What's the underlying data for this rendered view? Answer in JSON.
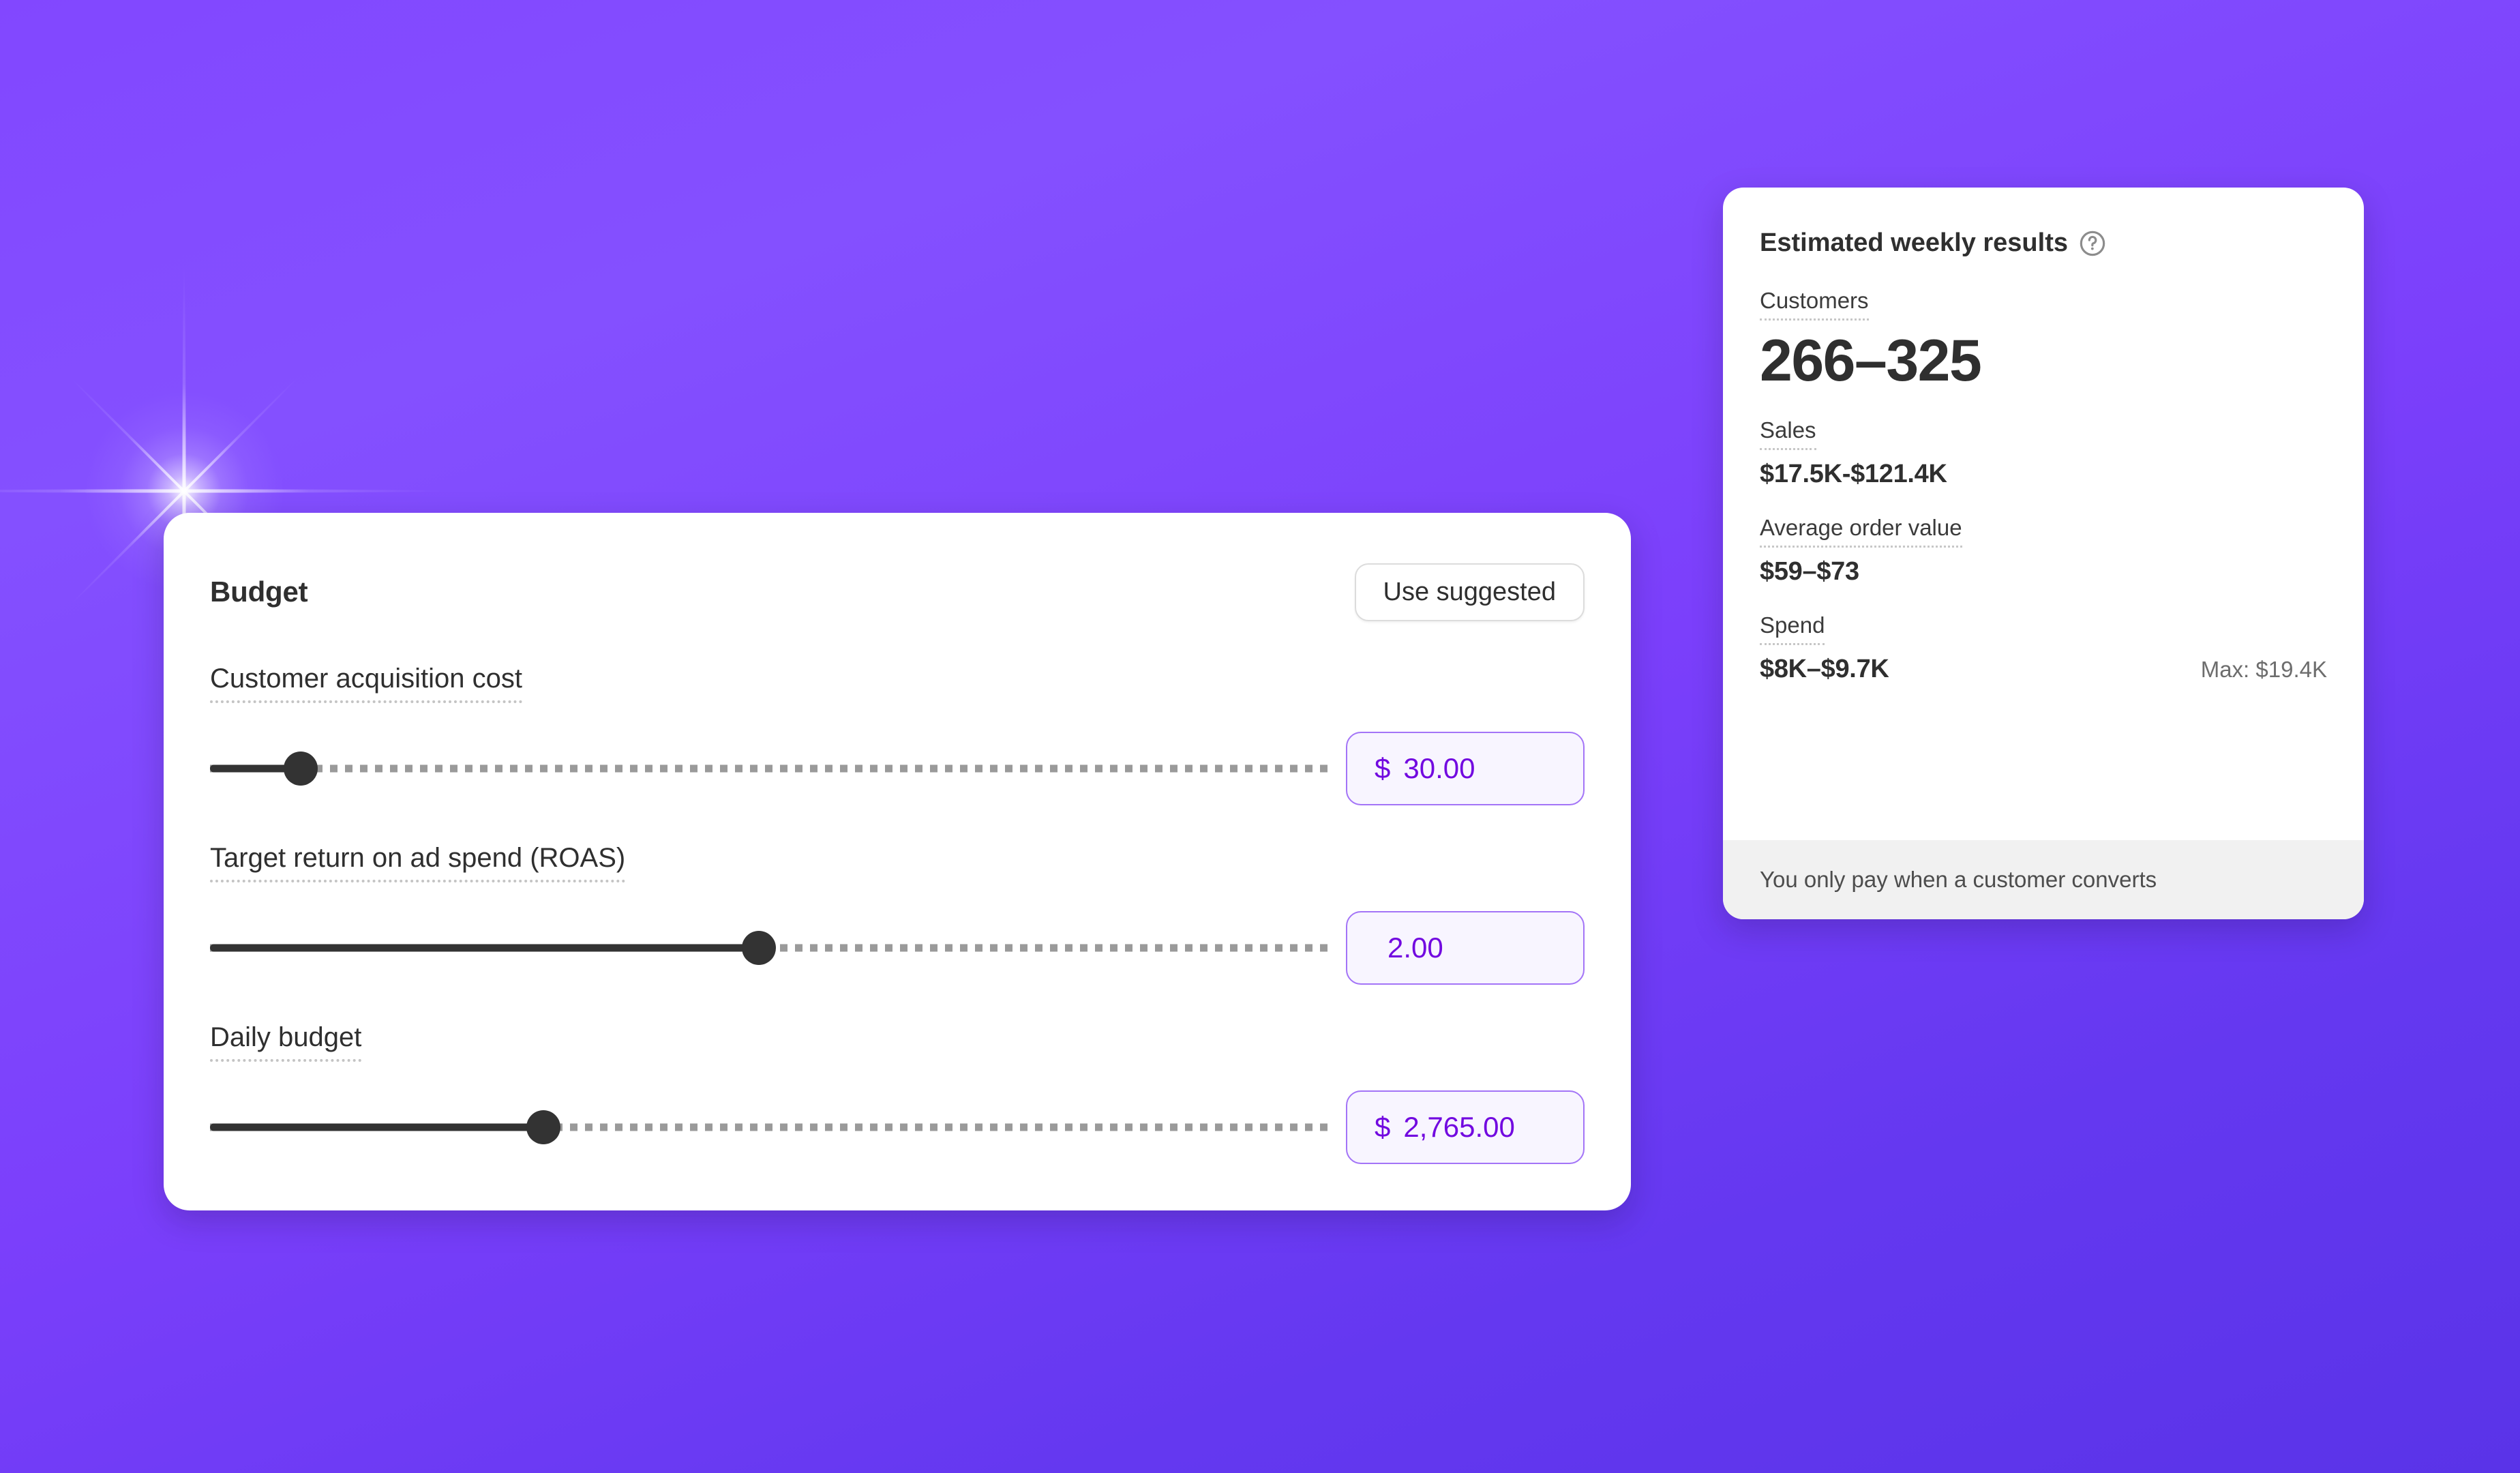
{
  "budget_card": {
    "title": "Budget",
    "use_suggested_label": "Use suggested",
    "fields": [
      {
        "label": "Customer acquisition cost",
        "currency": "$",
        "value": "30.00",
        "slider_percent": 8.1
      },
      {
        "label": "Target return on ad spend (ROAS)",
        "currency": "",
        "value": "2.00",
        "slider_percent": 49.0
      },
      {
        "label": "Daily budget",
        "currency": "$",
        "value": "2,765.00",
        "slider_percent": 29.8
      }
    ]
  },
  "results_card": {
    "title": "Estimated weekly results",
    "help_icon": "question-mark-circle-icon",
    "metrics": [
      {
        "label": "Customers",
        "value": "266–325",
        "sub": ""
      },
      {
        "label": "Sales",
        "value": "$17.5K-$121.4K",
        "sub": ""
      },
      {
        "label": "Average order value",
        "value": "$59–$73",
        "sub": ""
      },
      {
        "label": "Spend",
        "value": "$8K–$9.7K",
        "sub": "Max: $19.4K"
      }
    ],
    "footer_note": "You only pay when a customer converts"
  },
  "colors": {
    "background_start": "#8247FF",
    "background_end": "#5A33E8",
    "accent_purple": "#7209E0",
    "input_border": "#A374F7",
    "input_background": "#F8F5FF",
    "slider_fill": "#333333",
    "slider_track": "#9A9A9A",
    "text_primary": "#2F2F2F",
    "footer_background": "#F1F1F1"
  }
}
